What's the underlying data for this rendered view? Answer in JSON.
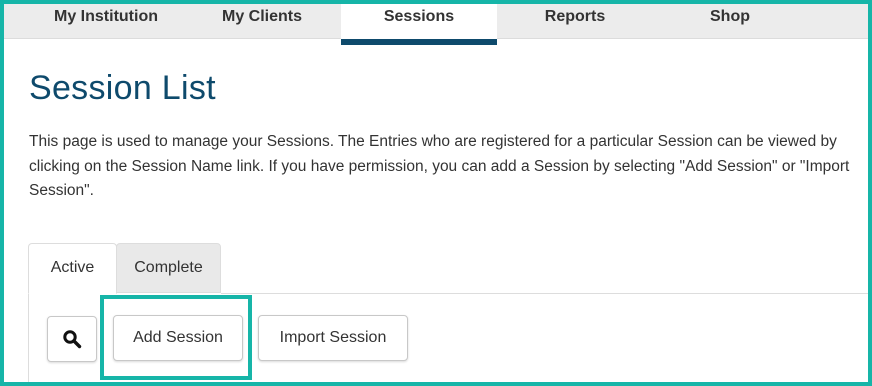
{
  "nav": {
    "items": [
      {
        "label": "My Institution"
      },
      {
        "label": "My Clients"
      },
      {
        "label": "Sessions",
        "active": true
      },
      {
        "label": "Reports"
      },
      {
        "label": "Shop"
      }
    ]
  },
  "page": {
    "title": "Session List",
    "description": "This page is used to manage your Sessions. The Entries who are registered for a particular Session can be viewed by clicking on the Session Name link. If you have permission, you can add a Session by selecting \"Add Session\" or \"Import Session\"."
  },
  "tabs": [
    {
      "label": "Active",
      "selected": true
    },
    {
      "label": "Complete",
      "selected": false
    }
  ],
  "toolbar": {
    "search_icon": "search-icon",
    "add_label": "Add Session",
    "import_label": "Import Session"
  },
  "colors": {
    "highlight": "#16b5a8",
    "brand": "#0e4a6c"
  }
}
